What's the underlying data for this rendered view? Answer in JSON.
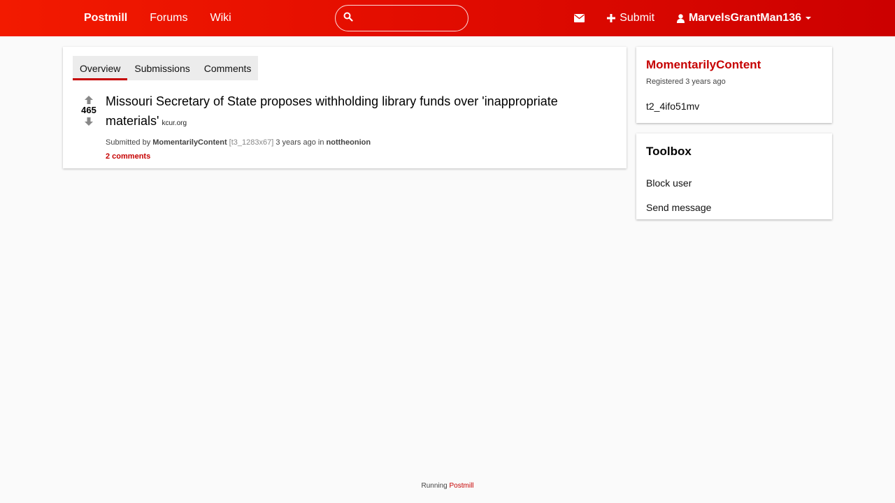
{
  "nav": {
    "brand": "Postmill",
    "forums": "Forums",
    "wiki": "Wiki",
    "search_value": "",
    "submit": "Submit",
    "username": "MarvelsGrantMan136"
  },
  "tabs": [
    {
      "label": "Overview",
      "active": true
    },
    {
      "label": "Submissions",
      "active": false
    },
    {
      "label": "Comments",
      "active": false
    }
  ],
  "submission": {
    "score": "465",
    "title": "Missouri Secretary of State proposes withholding library funds over 'inappropriate materials'",
    "domain": "kcur.org",
    "submitted_by_prefix": "Submitted by",
    "author": "MomentarilyContent",
    "id": "[t3_1283x67]",
    "time": "3 years ago in",
    "forum": "nottheonion",
    "comments": "2 comments"
  },
  "sidebar": {
    "user": {
      "name": "MomentarilyContent",
      "registered": "Registered 3 years ago",
      "id": "t2_4ifo51mv"
    },
    "toolbox": {
      "title": "Toolbox",
      "block": "Block user",
      "message": "Send message"
    }
  },
  "footer": {
    "running": "Running",
    "link": "Postmill"
  },
  "colors": {
    "accent": "#c60000",
    "nav_start": "#f31a00",
    "nav_end": "#cc0000"
  }
}
